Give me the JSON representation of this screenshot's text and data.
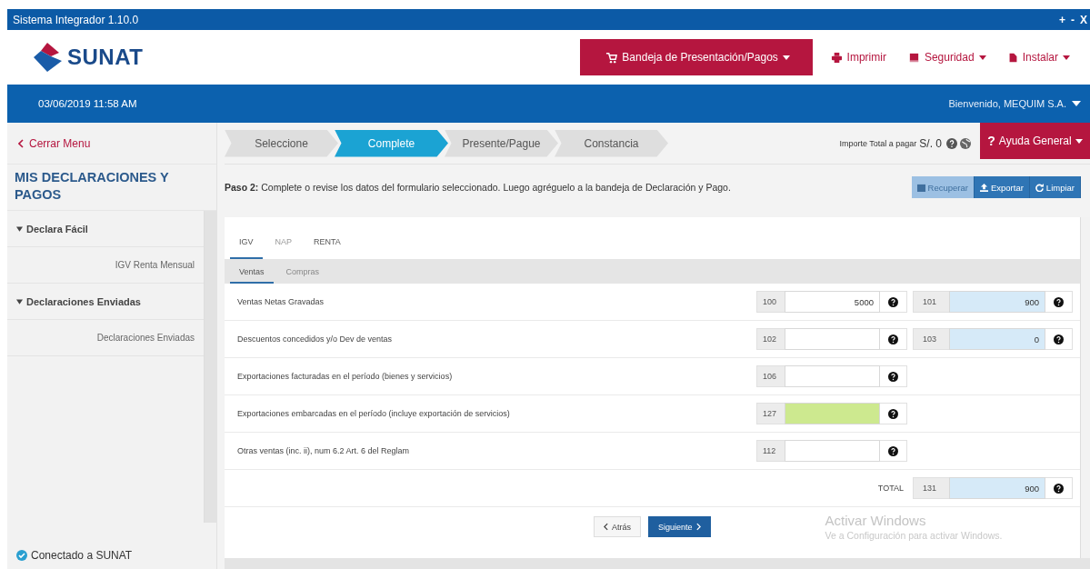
{
  "window": {
    "title": "Sistema Integrador 1.10.0",
    "controls": [
      "+",
      "-",
      "X"
    ]
  },
  "header": {
    "logo_text": "SUNAT",
    "menu": [
      {
        "label": "Bandeja de Presentación/Pagos",
        "kind": "primary",
        "dropdown": true
      },
      {
        "label": "Imprimir",
        "kind": "link",
        "dropdown": false
      },
      {
        "label": "Seguridad",
        "kind": "link",
        "dropdown": true
      },
      {
        "label": "Instalar",
        "kind": "link",
        "dropdown": true
      }
    ]
  },
  "info_bar": {
    "datetime": "03/06/2019 11:58 AM",
    "user": "Bienvenido, MEQUIM S.A."
  },
  "sidebar": {
    "close_label": "Cerrar Menu",
    "heading": "MIS DECLARACIONES Y PAGOS",
    "groups": [
      {
        "label": "Declara Fácil",
        "expanded": true,
        "children": [
          {
            "label": "IGV Renta Mensual"
          }
        ]
      },
      {
        "label": "Declaraciones Enviadas",
        "expanded": true,
        "children": [
          {
            "label": "Declaraciones Enviadas"
          }
        ]
      }
    ],
    "status": "Conectado a SUNAT"
  },
  "steps": [
    {
      "label": "Seleccione",
      "selected": false
    },
    {
      "label": "Complete",
      "selected": true
    },
    {
      "label": "Presente/Pague",
      "selected": false
    },
    {
      "label": "Constancia",
      "selected": false
    }
  ],
  "total_payable": {
    "label": "Importe Total a pagar",
    "amount": "S/. 0"
  },
  "help_button": {
    "icon": "?",
    "label": "Ayuda General"
  },
  "instruction": {
    "step": "Paso 2:",
    "text": "Complete o revise los datos del formulario seleccionado. Luego agréguelo a la bandeja de Declaración y Pago."
  },
  "actions": [
    {
      "label": "Recuperar",
      "disabled": true
    },
    {
      "label": "Exportar",
      "disabled": false
    },
    {
      "label": "Limpiar",
      "disabled": false
    }
  ],
  "tabs": [
    {
      "label": "IGV",
      "selected": true,
      "disabled": false
    },
    {
      "label": "NAP",
      "selected": false,
      "disabled": true
    },
    {
      "label": "RENTA",
      "selected": false,
      "disabled": false
    }
  ],
  "subtabs": [
    {
      "label": "Ventas",
      "selected": true,
      "disabled": false
    },
    {
      "label": "Compras",
      "selected": false,
      "disabled": true
    }
  ],
  "rows": [
    {
      "label": "Ventas Netas Gravadas",
      "fields": [
        {
          "code": "100",
          "value": "5000",
          "kind": "input"
        },
        {
          "code": "101",
          "value": "900",
          "kind": "computed"
        }
      ]
    },
    {
      "label": "Descuentos concedidos y/o Dev de ventas",
      "fields": [
        {
          "code": "102",
          "kind": "input"
        },
        {
          "code": "103",
          "value": "0",
          "kind": "computed"
        }
      ]
    },
    {
      "label": "Exportaciones facturadas en el período (bienes y servicios)",
      "fields": [
        {
          "code": "106",
          "kind": "input"
        }
      ]
    },
    {
      "label": "Exportaciones embarcadas en el período (incluye exportación de servicios)",
      "fields": [
        {
          "code": "127",
          "kind": "highlighted"
        }
      ]
    },
    {
      "label": "Otras ventas (inc. ii), num 6.2 Art. 6 del Reglam",
      "fields": [
        {
          "code": "112",
          "kind": "input"
        }
      ]
    }
  ],
  "total": {
    "label": "TOTAL",
    "code": "131",
    "value": "900",
    "kind": "computed"
  },
  "nav_buttons": [
    {
      "label": "Atrás",
      "kind": "back"
    },
    {
      "label": "Siguiente",
      "kind": "next"
    }
  ],
  "os_notice": {
    "title": "Activar Windows",
    "text": "Ve a Configuración para activar Windows."
  }
}
